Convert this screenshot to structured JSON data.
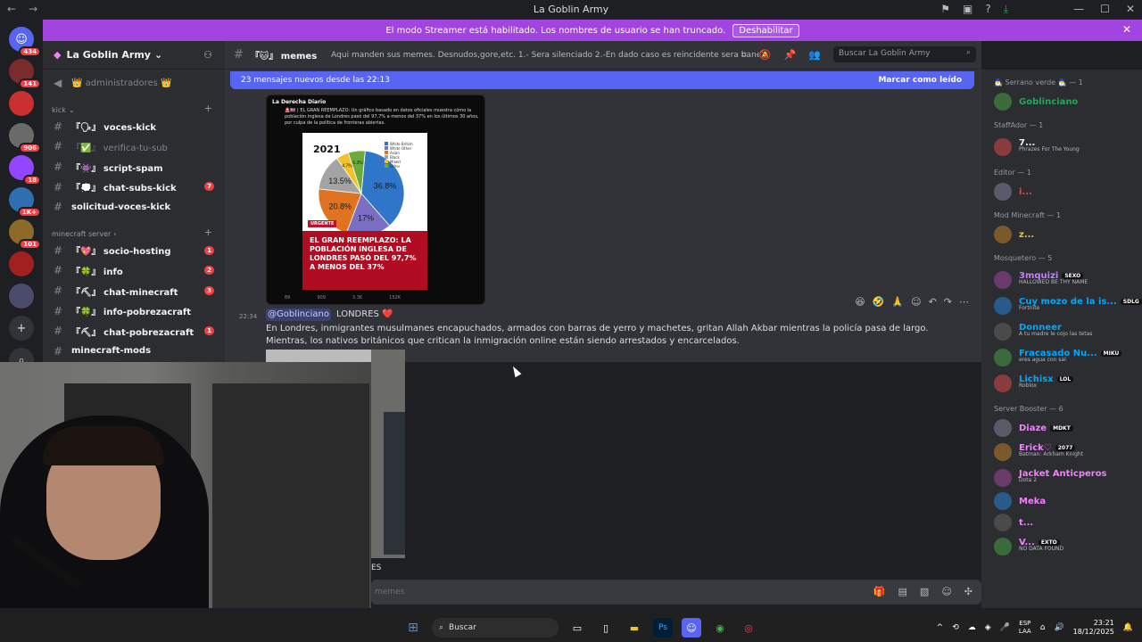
{
  "window": {
    "title": "La Goblin Army"
  },
  "colors": {
    "accent": "#5865f2",
    "banner": "#a144e0",
    "badge": "#f23f43",
    "online": "#23a55a"
  },
  "banner": {
    "text": "El modo Streamer está habilitado. Los nombres de usuario se han truncado.",
    "button": "Deshabilitar"
  },
  "server_rail": {
    "badges": [
      "434",
      "141",
      "",
      "906",
      "18",
      "1K+",
      "101",
      "",
      "",
      ""
    ]
  },
  "server": {
    "name": "La Goblin Army"
  },
  "channels": {
    "top": {
      "label": "👑 administradores 👑"
    },
    "cat1": {
      "label": "kick"
    },
    "list1": [
      {
        "prefix": "『🗣』",
        "label": "voces-kick",
        "badge": ""
      },
      {
        "prefix": "『✅』",
        "label": "verifica-tu-sub",
        "badge": ""
      },
      {
        "prefix": "『👾』",
        "label": "script-spam",
        "badge": ""
      },
      {
        "prefix": "『💭』",
        "label": "chat-subs-kick",
        "badge": "7"
      },
      {
        "prefix": "",
        "label": "solicitud-voces-kick",
        "badge": ""
      }
    ],
    "cat2": {
      "label": "minecraft server"
    },
    "list2": [
      {
        "prefix": "『💖』",
        "label": "socio-hosting",
        "badge": "1"
      },
      {
        "prefix": "『🍀』",
        "label": "info",
        "badge": "2"
      },
      {
        "prefix": "『⛏』",
        "label": "chat-minecraft",
        "badge": "3"
      },
      {
        "prefix": "『🍀』",
        "label": "info-pobrezacraft",
        "badge": ""
      },
      {
        "prefix": "『⛏』",
        "label": "chat-pobrezacraft",
        "badge": "1"
      },
      {
        "prefix": "",
        "label": "minecraft-mods",
        "badge": ""
      }
    ]
  },
  "channel_header": {
    "name": "『🐱』 memes",
    "topic": "Aqui manden sus memes. Desnudos,gore,etc. 1.- Sera silenciado 2.-En dado caso es reincidente sera baneado",
    "search_placeholder": "Buscar La Goblin Army"
  },
  "new_messages": {
    "text": "23 mensajes nuevos desde las 22:13",
    "action": "Marcar como leído"
  },
  "embed": {
    "source": "La Derecha Diario",
    "text": "🚨🇬🇧 | EL GRAN REEMPLAZO: Un gráfico basado en datos oficiales muestra cómo la población inglesa de Londres pasó del 97,7% a menos del 37% en los últimos 30 años, por culpa de la política de fronteras abiertas.",
    "year": "2021",
    "legend": [
      "White British",
      "White Other",
      "Asian",
      "Black",
      "Mixed",
      "Other"
    ],
    "slices": [
      {
        "label": "36.8%",
        "value": 36.8,
        "color": "#2f76c9"
      },
      {
        "label": "17%",
        "value": 17,
        "color": "#7b6fc4"
      },
      {
        "label": "20.8%",
        "value": 20.8,
        "color": "#e0731f"
      },
      {
        "label": "13.5%",
        "value": 13.5,
        "color": "#a3a3a3"
      },
      {
        "label": "4.7%",
        "value": 4.7,
        "color": "#f2c12e"
      },
      {
        "label": "6.3%",
        "value": 6.3,
        "color": "#6bab3b"
      }
    ],
    "tag": "URGENTE",
    "headline": "EL GRAN REEMPLAZO: LA POBLACIÓN INGLESA DE LONDRES PASÓ DEL 97,7% A MENOS DEL 37%",
    "footer": [
      "89",
      "909",
      "3.3K",
      "152K"
    ]
  },
  "message": {
    "time": "22:34",
    "mention": "@Goblinciano",
    "title": "LONDRES ❤️",
    "body": "En Londres, inmigrantes musulmanes encapuchados, armados con barras de yerro y machetes, gritan Allah Akbar mientras la policía pasa de largo. Mientras, los nativos británicos que critican la inmigración online están siendo arrestados y encarcelados."
  },
  "input": {
    "placeholder": "memes",
    "partial": "ES"
  },
  "members": {
    "groups": [
      {
        "title": "🧙‍♂️ Serrano verde 🧙‍♂️ — 1",
        "items": [
          {
            "name": "Goblinciano",
            "color": "#23a55a",
            "sub": "",
            "tag": ""
          }
        ]
      },
      {
        "title": "StaffAdor — 1",
        "items": [
          {
            "name": "7...",
            "color": "#f2f3f5",
            "sub": "Phrazes For The Young",
            "tag": ""
          }
        ]
      },
      {
        "title": "Editor — 1",
        "items": [
          {
            "name": "i...",
            "color": "#f23f43",
            "sub": "",
            "tag": ""
          }
        ]
      },
      {
        "title": "Mod Minecraft — 1",
        "items": [
          {
            "name": "z...",
            "color": "#f2c12e",
            "sub": "",
            "tag": ""
          }
        ]
      },
      {
        "title": "Mosquetero — 5",
        "items": [
          {
            "name": "3mquizi",
            "color": "#c77dff",
            "sub": "HALLOWED BE THY NAME",
            "tag": "SEXO"
          },
          {
            "name": "Cuy mozo de la is...",
            "color": "#00a8fc",
            "sub": "Fortnite",
            "tag": "SDLG"
          },
          {
            "name": "Donneer",
            "color": "#00a8fc",
            "sub": "A tu madre le cojo las tetas",
            "tag": ""
          },
          {
            "name": "Fracasado Nu...",
            "color": "#00a8fc",
            "sub": "eres agua con sal",
            "tag": "MIKU"
          },
          {
            "name": "Lichisx",
            "color": "#00a8fc",
            "sub": "Roblox",
            "tag": "LOL"
          }
        ]
      },
      {
        "title": "Server Booster — 6",
        "items": [
          {
            "name": "Diaze",
            "color": "#f47fff",
            "sub": "",
            "tag": "MDKT"
          },
          {
            "name": "Erick♡",
            "color": "#f47fff",
            "sub": "Batman: Arkham Knight",
            "tag": "2077"
          },
          {
            "name": "Jacket Anticperos",
            "color": "#f47fff",
            "sub": "Dota 2",
            "tag": ""
          },
          {
            "name": "Meka",
            "color": "#f47fff",
            "sub": "",
            "tag": ""
          },
          {
            "name": "t...",
            "color": "#f47fff",
            "sub": "",
            "tag": ""
          },
          {
            "name": "V...",
            "color": "#f47fff",
            "sub": "NO DATA FOUND",
            "tag": "EXTO"
          }
        ]
      }
    ]
  },
  "taskbar": {
    "search": "Buscar",
    "lang": "ESP",
    "lang2": "LAA",
    "time": "23:21",
    "date": "18/12/2025"
  }
}
